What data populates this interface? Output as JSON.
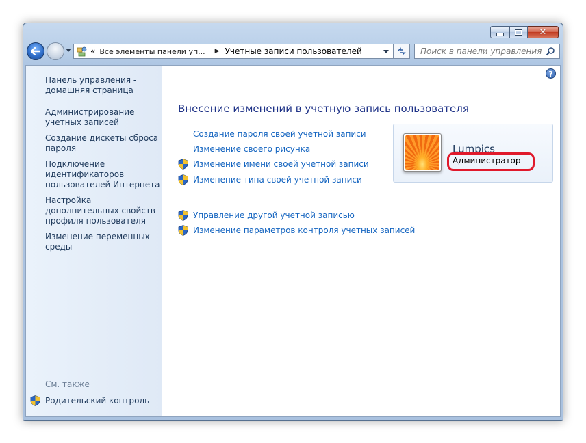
{
  "window": {
    "caption_buttons": [
      "minimize",
      "maximize",
      "close"
    ]
  },
  "navbar": {
    "breadcrumb_prefix": "«",
    "breadcrumb": [
      "Все элементы панели уп...",
      "Учетные записи пользователей"
    ],
    "search_placeholder": "Поиск в панели управления"
  },
  "sidebar": {
    "items": [
      "Панель управления - домашняя страница",
      "Администрирование учетных записей",
      "Создание дискеты сброса пароля",
      "Подключение идентификаторов пользователей Интернета",
      "Настройка дополнительных свойств профиля пользователя",
      "Изменение переменных среды"
    ],
    "see_also_label": "См. также",
    "see_also_items": [
      "Родительский контроль"
    ]
  },
  "main": {
    "title": "Внесение изменений в учетную запись пользователя",
    "tasks": [
      {
        "label": "Создание пароля своей учетной записи",
        "shield": false
      },
      {
        "label": "Изменение своего рисунка",
        "shield": false
      },
      {
        "label": "Изменение имени своей учетной записи",
        "shield": true
      },
      {
        "label": "Изменение типа своей учетной записи",
        "shield": true
      },
      {
        "label": "Управление другой учетной записью",
        "shield": true
      },
      {
        "label": "Изменение параметров контроля учетных записей",
        "shield": true
      }
    ]
  },
  "user": {
    "name": "Lumpics",
    "role": "Администратор"
  },
  "colors": {
    "link": "#1565c0",
    "title": "#1e3287",
    "highlight": "#e0192b",
    "sidebar": "#e4edf8"
  }
}
